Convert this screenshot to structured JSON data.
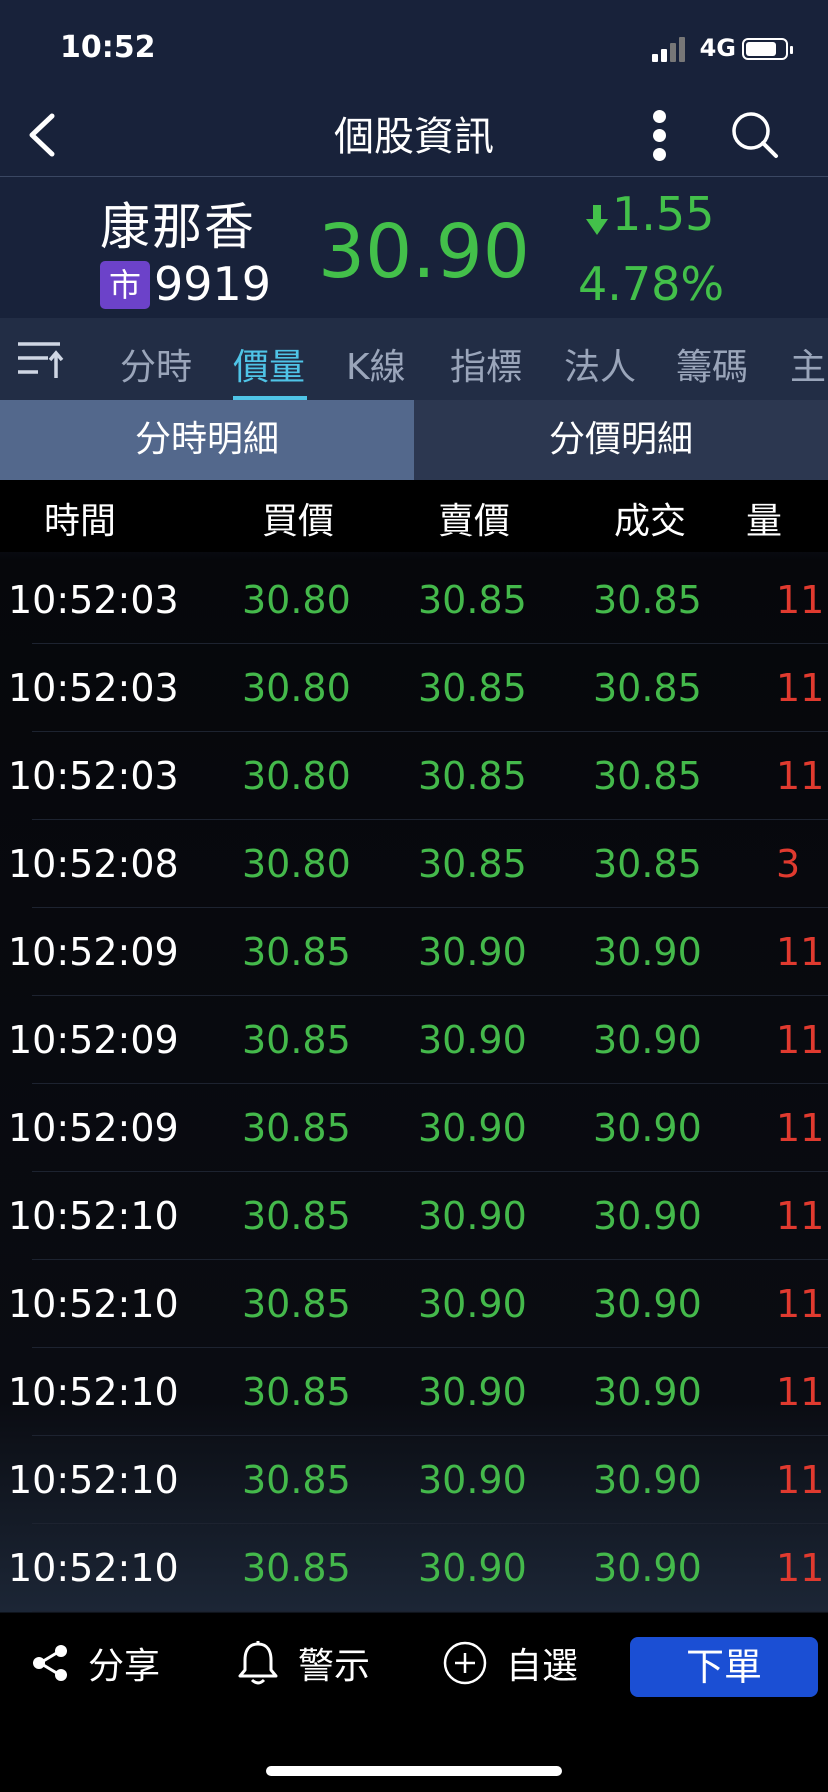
{
  "status_bar": {
    "time": "10:52",
    "network": "4G",
    "battery_level": 0.8
  },
  "nav": {
    "title": "個股資訊"
  },
  "stock": {
    "name": "康那香",
    "market_badge": "市",
    "code": "9919",
    "price": "30.90",
    "change": "1.55",
    "change_pct": "4.78%",
    "change_direction": "down"
  },
  "tabs": [
    {
      "label": "分時"
    },
    {
      "label": "價量"
    },
    {
      "label": "K線"
    },
    {
      "label": "指標"
    },
    {
      "label": "法人"
    },
    {
      "label": "籌碼"
    },
    {
      "label": "主"
    }
  ],
  "active_tab": "價量",
  "segments": {
    "left": "分時明細",
    "right": "分價明細"
  },
  "table": {
    "headers": {
      "time": "時間",
      "bid": "買價",
      "ask": "賣價",
      "deal": "成交",
      "volume": "量"
    },
    "rows": [
      {
        "time": "10:52:03",
        "bid": "30.80",
        "ask": "30.85",
        "deal": "30.85",
        "volume": "11"
      },
      {
        "time": "10:52:03",
        "bid": "30.80",
        "ask": "30.85",
        "deal": "30.85",
        "volume": "11"
      },
      {
        "time": "10:52:03",
        "bid": "30.80",
        "ask": "30.85",
        "deal": "30.85",
        "volume": "11"
      },
      {
        "time": "10:52:08",
        "bid": "30.80",
        "ask": "30.85",
        "deal": "30.85",
        "volume": "3"
      },
      {
        "time": "10:52:09",
        "bid": "30.85",
        "ask": "30.90",
        "deal": "30.90",
        "volume": "11"
      },
      {
        "time": "10:52:09",
        "bid": "30.85",
        "ask": "30.90",
        "deal": "30.90",
        "volume": "11"
      },
      {
        "time": "10:52:09",
        "bid": "30.85",
        "ask": "30.90",
        "deal": "30.90",
        "volume": "11"
      },
      {
        "time": "10:52:10",
        "bid": "30.85",
        "ask": "30.90",
        "deal": "30.90",
        "volume": "11"
      },
      {
        "time": "10:52:10",
        "bid": "30.85",
        "ask": "30.90",
        "deal": "30.90",
        "volume": "11"
      },
      {
        "time": "10:52:10",
        "bid": "30.85",
        "ask": "30.90",
        "deal": "30.90",
        "volume": "11"
      },
      {
        "time": "10:52:10",
        "bid": "30.85",
        "ask": "30.90",
        "deal": "30.90",
        "volume": "11"
      },
      {
        "time": "10:52:10",
        "bid": "30.85",
        "ask": "30.90",
        "deal": "30.90",
        "volume": "11"
      }
    ]
  },
  "toolbar": {
    "share": "分享",
    "alert": "警示",
    "watchlist": "自選",
    "order": "下單"
  },
  "colors": {
    "up": "#e03a2f",
    "down": "#44b94b",
    "accent": "#4fc4e7",
    "order_button": "#1b4fd4",
    "market_badge": "#6c42c9"
  }
}
